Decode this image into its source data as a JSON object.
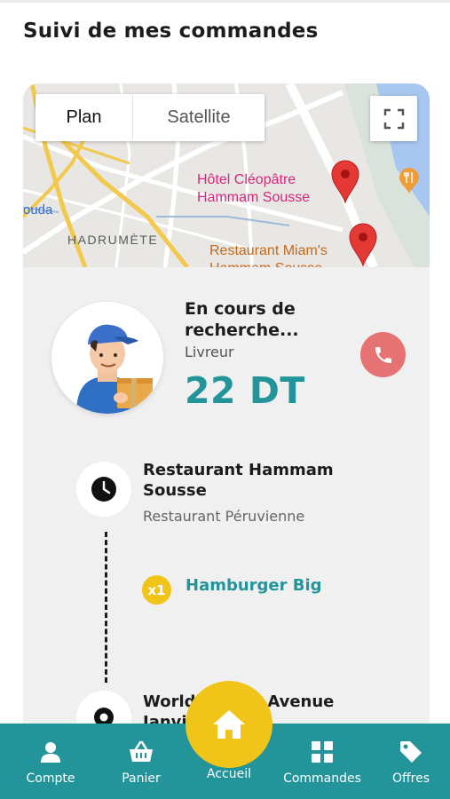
{
  "page": {
    "title": "Suivi de mes commandes"
  },
  "map": {
    "type_plan": "Plan",
    "type_satellite": "Satellite",
    "labels": {
      "hotel": "Hôtel Cléopâtre\nHammam Sousse",
      "restaurant": "Restaurant Miam's\nHammam Sousse",
      "city": "HADRUMÈTE",
      "partial": "ouda"
    },
    "icons": {
      "fullscreen": "fullscreen-icon",
      "pin": "map-pin-icon",
      "restaurant_poi": "fork-knife-icon"
    }
  },
  "courier": {
    "status": "En cours de recherche...",
    "role": "Livreur",
    "price": "22 DT",
    "call_icon": "phone-icon"
  },
  "timeline": {
    "pickup": {
      "icon": "clock-icon",
      "name": "Restaurant Hammam Sousse",
      "description": "Restaurant Péruvienne",
      "items": [
        {
          "qty": "x1",
          "name": "Hamburger Big"
        }
      ]
    },
    "dropoff": {
      "icon": "location-icon",
      "name_partial": "World Travel, Avenue Janvier"
    }
  },
  "nav": {
    "compte": "Compte",
    "panier": "Panier",
    "accueil": "Accueil",
    "commandes": "Commandes",
    "offres": "Offres"
  },
  "colors": {
    "accent": "#23959a",
    "yellow": "#f0c419",
    "call": "#e57373"
  }
}
